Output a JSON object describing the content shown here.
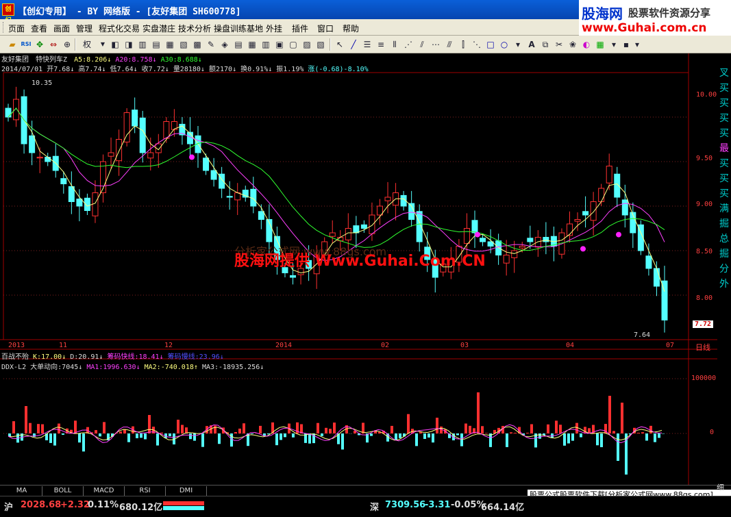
{
  "window": {
    "title": "【创幻专用】 - BY 网络版 - [友好集团 SH600778]",
    "app_icon_text": "创幻"
  },
  "brand": {
    "logo": "股海网",
    "slogan": "股票软件资源分享",
    "url": "www.Guhai.com.cn"
  },
  "menu": [
    "页面",
    "查看",
    "画面",
    "管理",
    "程式化交易",
    "实盘潜庄",
    "技术分析",
    "操盘训练基地",
    "外挂",
    "插件",
    "窗口",
    "帮助"
  ],
  "toolbar": {
    "weight_label": "权",
    "icons": [
      "folder-icon",
      "rsi-icon",
      "arrows-icon",
      "pan-icon",
      "zoom-in-icon",
      "zoom-out-icon",
      "prev-icon",
      "next-icon",
      "layout1-icon",
      "layout2-icon",
      "layout3-icon",
      "layout4-icon",
      "indicator-icon",
      "chart-icon",
      "cursor-icon",
      "line-icon",
      "fib-icon",
      "gann-icon",
      "fan-icon",
      "channel-icon",
      "rect-icon",
      "ellipse-icon",
      "text-icon",
      "copy-icon",
      "magic-icon",
      "palette-icon",
      "save-icon"
    ]
  },
  "kchart": {
    "name": "友好集团",
    "indicator": "特快列车Z",
    "ma5_label": "A5:8.206",
    "ma20_label": "A20:8.758",
    "ma30_label": "A30:8.688",
    "date": "2014/07/01",
    "open": "开7.68",
    "high": "高7.74",
    "low": "低7.64",
    "close": "收7.72",
    "volume": "量28180",
    "amount": "额2170",
    "turnover": "换0.91%",
    "amplitude": "振1.19%",
    "change": "涨(-0.68)-8.10%",
    "high_mark": "10.35",
    "low_mark": "7.64",
    "last_price": "7.72",
    "y_ticks": [
      "10.00",
      "9.50",
      "9.00",
      "8.50",
      "8.00"
    ],
    "x_labels": [
      "2013",
      "11",
      "12",
      "2014",
      "02",
      "03",
      "04",
      "07"
    ],
    "period": "日线",
    "side_text": [
      "叉",
      "买",
      "买",
      "买",
      "买",
      "最",
      "买",
      "买",
      "买",
      "满",
      "掘",
      "总",
      "掘",
      "分",
      "外"
    ],
    "colors": {
      "up": "#ff3030",
      "down": "#54ffff",
      "ma5": "#ffff80",
      "ma20": "#ff40ff",
      "ma30": "#30ff30"
    }
  },
  "sub1": {
    "name": "百战不殆",
    "k_label": "K:17.00",
    "d_label": "D:20.91",
    "chip_fast": "筹码快线:18.41",
    "chip_slow": "筹码慢线:23.96"
  },
  "sub2": {
    "name": "DDX-L2",
    "title": "大单动向:7045",
    "ma1": "MA1:1996.630",
    "ma2": "MA2:-740.018",
    "ma3": "MA3:-18935.256",
    "y_ticks": [
      "100000",
      "0"
    ]
  },
  "watermark": {
    "main": "股海网提供 Www.Guhai.Com.CN",
    "faint": "分析家公式网 www.88gs.com"
  },
  "tabs": [
    "MA",
    "BOLL",
    "MACD",
    "RSI",
    "DMI"
  ],
  "status": {
    "sh_label": "沪",
    "sh_index": "2028.68",
    "sh_change": "+2.32",
    "sh_pct": "0.11%",
    "sh_amount": "680.12亿",
    "sz_label": "深",
    "sz_index": "7309.56",
    "sz_change": "-3.31",
    "sz_pct": "-0.05%",
    "sz_amount": "664.14亿",
    "ad_text": "股票公式股票软件下载[分析家公式网www.88gs.com]",
    "corner": "细"
  },
  "chart_data": {
    "type": "candlestick",
    "y_range": [
      7.5,
      10.5
    ],
    "ohlc_close": [
      10.0,
      10.2,
      9.7,
      9.6,
      9.55,
      9.5,
      9.4,
      9.25,
      9.05,
      9.0,
      8.95,
      9.15,
      9.5,
      9.6,
      9.75,
      10.05,
      9.9,
      9.6,
      9.6,
      9.7,
      9.95,
      9.95,
      9.8,
      9.7,
      9.6,
      9.4,
      9.3,
      9.2,
      9.1,
      9.15,
      9.1,
      9.0,
      8.85,
      8.6,
      8.4,
      8.25,
      8.2,
      8.3,
      8.3,
      8.45,
      8.6,
      8.7,
      8.65,
      8.75,
      8.7,
      8.75,
      8.9,
      9.0,
      9.1,
      9.15,
      9.0,
      8.85,
      8.6,
      8.4,
      8.2,
      8.35,
      8.4,
      8.55,
      8.75,
      8.7,
      8.6,
      8.55,
      8.45,
      8.45,
      8.5,
      8.55,
      8.6,
      8.65,
      8.6,
      8.55,
      8.7,
      8.8,
      8.85,
      8.9,
      9.05,
      9.2,
      9.45,
      9.1,
      8.9,
      8.7,
      8.5,
      8.3,
      8.1,
      7.72
    ],
    "volume_bars_note": "DDX bars alternate up (red) / down (cyan)"
  }
}
